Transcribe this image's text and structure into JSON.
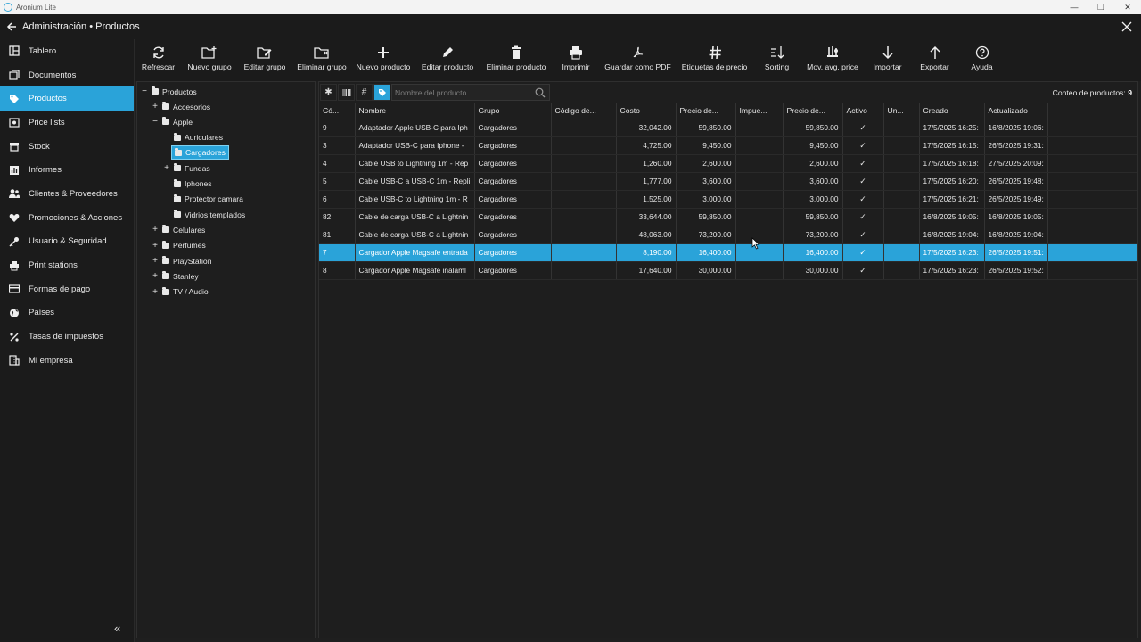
{
  "window": {
    "title": "Aronium Lite"
  },
  "header": {
    "breadcrumb": "Administración • Productos"
  },
  "sidebar": {
    "items": [
      {
        "label": "Tablero",
        "icon": "dashboard-icon"
      },
      {
        "label": "Documentos",
        "icon": "documents-icon"
      },
      {
        "label": "Productos",
        "icon": "tag-icon",
        "active": true
      },
      {
        "label": "Price lists",
        "icon": "price-list-icon"
      },
      {
        "label": "Stock",
        "icon": "stock-icon"
      },
      {
        "label": "Informes",
        "icon": "reports-icon"
      },
      {
        "label": "Clientes & Proveedores",
        "icon": "users-icon"
      },
      {
        "label": "Promociones & Acciones",
        "icon": "heart-icon"
      },
      {
        "label": "Usuario & Seguridad",
        "icon": "key-icon"
      },
      {
        "label": "Print stations",
        "icon": "printer-icon"
      },
      {
        "label": "Formas de pago",
        "icon": "card-icon"
      },
      {
        "label": "Países",
        "icon": "globe-icon"
      },
      {
        "label": "Tasas de impuestos",
        "icon": "percent-icon"
      },
      {
        "label": "Mi empresa",
        "icon": "building-icon"
      }
    ]
  },
  "toolbar": {
    "buttons": [
      {
        "label": "Refrescar",
        "icon": "refresh-icon"
      },
      {
        "label": "Nuevo grupo",
        "icon": "new-folder-icon"
      },
      {
        "label": "Editar grupo",
        "icon": "edit-folder-icon"
      },
      {
        "label": "Eliminar grupo",
        "icon": "delete-folder-icon"
      },
      {
        "label": "Nuevo producto",
        "icon": "plus-icon"
      },
      {
        "label": "Editar producto",
        "icon": "pencil-icon"
      },
      {
        "label": "Eliminar producto",
        "icon": "trash-icon"
      },
      {
        "label": "Imprimir",
        "icon": "printer-icon"
      },
      {
        "label": "Guardar como PDF",
        "icon": "pdf-icon"
      },
      {
        "label": "Etiquetas de precio",
        "icon": "hash-icon"
      },
      {
        "label": "Sorting",
        "icon": "sort-icon"
      },
      {
        "label": "Mov. avg. price",
        "icon": "scale-icon"
      },
      {
        "label": "Importar",
        "icon": "arrow-down-icon"
      },
      {
        "label": "Exportar",
        "icon": "arrow-up-icon"
      },
      {
        "label": "Ayuda",
        "icon": "help-icon"
      }
    ]
  },
  "tree": {
    "root": "Productos",
    "nodes": [
      {
        "label": "Accesorios",
        "level": 1,
        "expander": "+"
      },
      {
        "label": "Apple",
        "level": 1,
        "expander": "−"
      },
      {
        "label": "Auriculares",
        "level": 2,
        "expander": ""
      },
      {
        "label": "Cargadores",
        "level": 2,
        "expander": "",
        "selected": true
      },
      {
        "label": "Fundas",
        "level": 2,
        "expander": "+"
      },
      {
        "label": "Iphones",
        "level": 2,
        "expander": ""
      },
      {
        "label": "Protector camara",
        "level": 2,
        "expander": ""
      },
      {
        "label": "Vidrios templados",
        "level": 2,
        "expander": ""
      },
      {
        "label": "Celulares",
        "level": 1,
        "expander": "+"
      },
      {
        "label": "Perfumes",
        "level": 1,
        "expander": "+"
      },
      {
        "label": "PlayStation",
        "level": 1,
        "expander": "+"
      },
      {
        "label": "Stanley",
        "level": 1,
        "expander": "+"
      },
      {
        "label": "TV / Audio",
        "level": 1,
        "expander": "+"
      }
    ]
  },
  "filter": {
    "placeholder": "Nombre del producto",
    "count_label": "Conteo de productos:",
    "count_value": "9"
  },
  "grid": {
    "columns": [
      "Có...",
      "Nombre",
      "Grupo",
      "Código de...",
      "Costo",
      "Precio de...",
      "Impue...",
      "Precio de...",
      "Activo",
      "Un...",
      "Creado",
      "Actualizado"
    ],
    "rows": [
      {
        "code": "9",
        "name": "Adaptador Apple USB-C para Iph",
        "group": "Cargadores",
        "barcode": "",
        "cost": "32,042.00",
        "price": "59,850.00",
        "tax": "",
        "price_tax": "59,850.00",
        "active": "✓",
        "unit": "",
        "created": "17/5/2025 16:25:",
        "updated": "16/8/2025 19:06:"
      },
      {
        "code": "3",
        "name": "Adaptador USB-C para Iphone -",
        "group": "Cargadores",
        "barcode": "",
        "cost": "4,725.00",
        "price": "9,450.00",
        "tax": "",
        "price_tax": "9,450.00",
        "active": "✓",
        "unit": "",
        "created": "17/5/2025 16:15:",
        "updated": "26/5/2025 19:31:"
      },
      {
        "code": "4",
        "name": "Cable USB to Lightning 1m - Rep",
        "group": "Cargadores",
        "barcode": "",
        "cost": "1,260.00",
        "price": "2,600.00",
        "tax": "",
        "price_tax": "2,600.00",
        "active": "✓",
        "unit": "",
        "created": "17/5/2025 16:18:",
        "updated": "27/5/2025 20:09:"
      },
      {
        "code": "5",
        "name": "Cable USB-C a USB-C 1m - Repli",
        "group": "Cargadores",
        "barcode": "",
        "cost": "1,777.00",
        "price": "3,600.00",
        "tax": "",
        "price_tax": "3,600.00",
        "active": "✓",
        "unit": "",
        "created": "17/5/2025 16:20:",
        "updated": "26/5/2025 19:48:"
      },
      {
        "code": "6",
        "name": "Cable USB-C to Lightning 1m - R",
        "group": "Cargadores",
        "barcode": "",
        "cost": "1,525.00",
        "price": "3,000.00",
        "tax": "",
        "price_tax": "3,000.00",
        "active": "✓",
        "unit": "",
        "created": "17/5/2025 16:21:",
        "updated": "26/5/2025 19:49:"
      },
      {
        "code": "82",
        "name": "Cable de carga USB-C a Lightnin",
        "group": "Cargadores",
        "barcode": "",
        "cost": "33,644.00",
        "price": "59,850.00",
        "tax": "",
        "price_tax": "59,850.00",
        "active": "✓",
        "unit": "",
        "created": "16/8/2025 19:05:",
        "updated": "16/8/2025 19:05:"
      },
      {
        "code": "81",
        "name": "Cable de carga USB-C a Lightnin",
        "group": "Cargadores",
        "barcode": "",
        "cost": "48,063.00",
        "price": "73,200.00",
        "tax": "",
        "price_tax": "73,200.00",
        "active": "✓",
        "unit": "",
        "created": "16/8/2025 19:04:",
        "updated": "16/8/2025 19:04:"
      },
      {
        "code": "7",
        "name": "Cargador Apple Magsafe entrada",
        "group": "Cargadores",
        "barcode": "",
        "cost": "8,190.00",
        "price": "16,400.00",
        "tax": "",
        "price_tax": "16,400.00",
        "active": "✓",
        "unit": "",
        "created": "17/5/2025 16:23:",
        "updated": "26/5/2025 19:51:",
        "selected": true
      },
      {
        "code": "8",
        "name": "Cargador Apple Magsafe inalaml",
        "group": "Cargadores",
        "barcode": "",
        "cost": "17,640.00",
        "price": "30,000.00",
        "tax": "",
        "price_tax": "30,000.00",
        "active": "✓",
        "unit": "",
        "created": "17/5/2025 16:23:",
        "updated": "26/5/2025 19:52:"
      }
    ]
  },
  "colors": {
    "accent": "#2aa3d9",
    "background": "#1f1f1f"
  }
}
